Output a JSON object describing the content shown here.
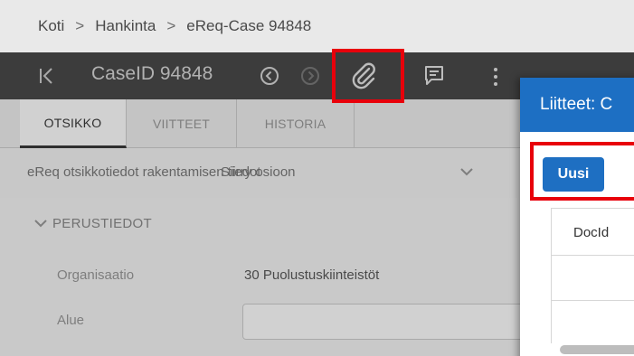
{
  "breadcrumb": {
    "items": [
      "Koti",
      "Hankinta",
      "eReq-Case 94848"
    ],
    "separator": ">"
  },
  "header": {
    "case_title": "CaseID 94848"
  },
  "tabs": [
    {
      "label": "OTSIKKO",
      "active": true
    },
    {
      "label": "VIITTEET",
      "active": false
    },
    {
      "label": "HISTORIA",
      "active": false
    }
  ],
  "info_dropdown": {
    "text": "eReq otsikkotiedot rakentamisen tiedot",
    "overlay_text": "Siirry osioon"
  },
  "section": {
    "title": "PERUSTIEDOT",
    "fields": [
      {
        "label": "Organisaatio",
        "value": "30 Puolustuskiinteistöt"
      },
      {
        "label": "Alue",
        "value": ""
      }
    ]
  },
  "attachments_panel": {
    "title": "Liitteet: C",
    "new_button": "Uusi",
    "column_header": "DocId"
  },
  "colors": {
    "header_bg": "#4a4a4a",
    "panel_blue": "#1d6fc3",
    "highlight_red": "#e8000b"
  }
}
